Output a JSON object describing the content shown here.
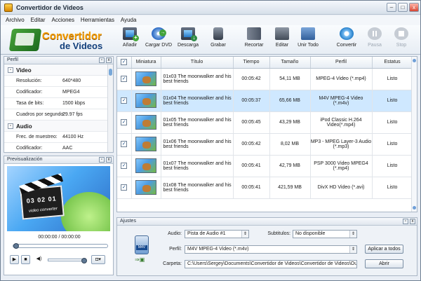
{
  "window": {
    "title": "Convertidor de Videos"
  },
  "window_controls": {
    "minimize": "–",
    "maximize": "□",
    "close": "x"
  },
  "menu": [
    "Archivo",
    "Editar",
    "Acciones",
    "Herramientas",
    "Ayuda"
  ],
  "logo": {
    "line1": "Convertidor",
    "line2": "de Videos"
  },
  "toolbar": [
    {
      "label": "Añadir",
      "icon": "add-video-icon",
      "enabled": true
    },
    {
      "label": "Cargar DVD",
      "icon": "dvd-icon",
      "enabled": true
    },
    {
      "label": "Descarga",
      "icon": "download-icon",
      "enabled": true
    },
    {
      "label": "Grabar",
      "icon": "device-icon",
      "enabled": true
    },
    {
      "label": "Recortar",
      "icon": "trim-icon",
      "enabled": true
    },
    {
      "label": "Editar",
      "icon": "edit-icon",
      "enabled": true
    },
    {
      "label": "Unir Todo",
      "icon": "join-icon",
      "enabled": true
    },
    {
      "label": "Convertir",
      "icon": "convert-icon",
      "enabled": true
    },
    {
      "label": "Pausa",
      "icon": "pause-icon",
      "enabled": false
    },
    {
      "label": "Stop",
      "icon": "stop-icon",
      "enabled": false
    }
  ],
  "profile_panel": {
    "title": "Perfil",
    "groups": [
      {
        "name": "Video",
        "rows": [
          {
            "key": "Resolución:",
            "value": "640*480"
          },
          {
            "key": "Codificador:",
            "value": "MPEG4"
          },
          {
            "key": "Tasa de bits:",
            "value": "1500 kbps"
          },
          {
            "key": "Cuadros por segundo:",
            "value": "29.97 fps"
          }
        ]
      },
      {
        "name": "Audio",
        "rows": [
          {
            "key": "Frec. de muestreo:",
            "value": "44100 Hz"
          },
          {
            "key": "Codificador:",
            "value": "AAC"
          }
        ]
      }
    ]
  },
  "preview_panel": {
    "title": "Previsualización",
    "clapper_text": "03 02 01",
    "clapper_subtext": "video converter",
    "timecode": "00:00:00 / 00:00:00",
    "seek_position": 0,
    "volume_level": 1
  },
  "table": {
    "headers": [
      "Miniatura",
      "Título",
      "Tiempo",
      "Tamaño",
      "Perfil",
      "Estatus"
    ],
    "rows": [
      {
        "checked": "✓",
        "title": "01x03 The moonwalker and his best friends",
        "time": "00:05:42",
        "size": "54,11 MB",
        "profile": "MPEG-4 Video (*.mp4)",
        "status": "Listo"
      },
      {
        "checked": "✓",
        "title": "01x04 The moonwalker and his best friends",
        "time": "00:05:37",
        "size": "65,66 MB",
        "profile": "M4V MPEG-4 Video (*.m4v)",
        "status": "Listo"
      },
      {
        "checked": "✓",
        "title": "01x05 The moonwalker and his best friends",
        "time": "00:05:45",
        "size": "43,29 MB",
        "profile": "iPod Classic H.264 Video(*.mp4)",
        "status": "Listo"
      },
      {
        "checked": "✓",
        "title": "01x06 The moonwalker and his best friends",
        "time": "00:05:42",
        "size": "8,02 MB",
        "profile": "MP3 - MPEG Layer-3 Audio (*.mp3)",
        "status": "Listo"
      },
      {
        "checked": "✓",
        "title": "01x07 The moonwalker and his best friends",
        "time": "00:05:41",
        "size": "42,79 MB",
        "profile": "PSP 3000 Video MPEG4 (*.mp4)",
        "status": "Listo"
      },
      {
        "checked": "✓",
        "title": "01x08 The moonwalker and his best friends",
        "time": "00:05:41",
        "size": "421,59 MB",
        "profile": "DivX HD Video (*.avi)",
        "status": "Listo"
      }
    ]
  },
  "settings": {
    "title": "Ajustes",
    "audio_label": "Audio:",
    "audio_value": "Pista de Audio #1",
    "subtitles_label": "Subtitulos:",
    "subtitles_value": "No disponible",
    "profile_label": "Perfil:",
    "profile_value": "M4V MPEG-4 Video (*.m4v)",
    "folder_label": "Carpeta:",
    "folder_value": "C:\\Users\\Sergey\\Documents\\Convertidor de Videos\\Convertidor de Videos\\Ou",
    "apply_all": "Aplicar a todos",
    "open": "Abrir"
  },
  "colors": {
    "selected_row": "#cfe8ff",
    "accent": "#f39c00",
    "brand_blue": "#123f7b"
  }
}
